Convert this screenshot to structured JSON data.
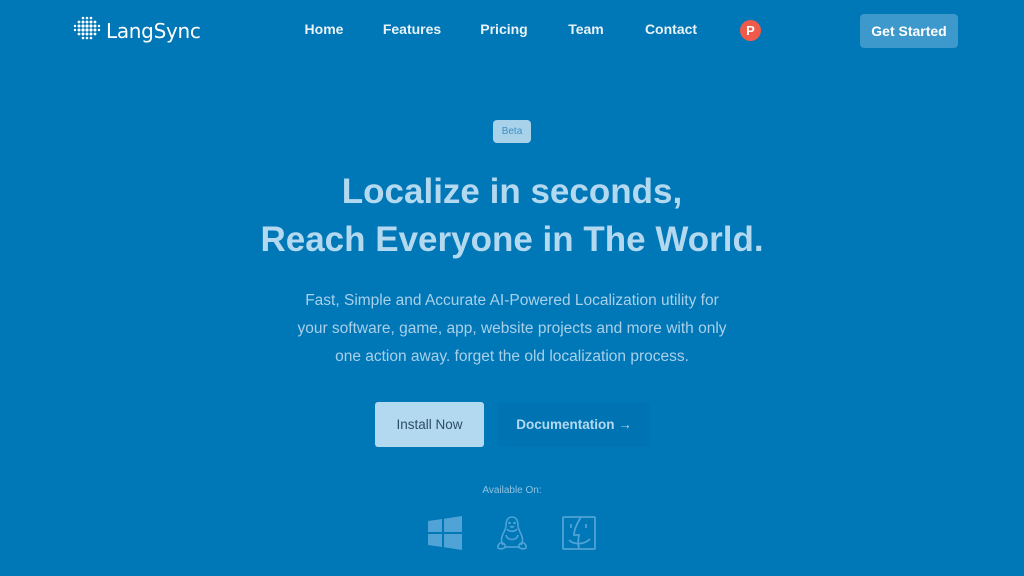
{
  "brand": {
    "name": "LangSync",
    "logo_icon": "globe-dots-icon"
  },
  "nav": {
    "links": [
      {
        "label": "Home"
      },
      {
        "label": "Features"
      },
      {
        "label": "Pricing"
      },
      {
        "label": "Team"
      },
      {
        "label": "Contact"
      }
    ],
    "product_hunt_badge": "P",
    "cta_label": "Get Started"
  },
  "hero": {
    "badge": "Beta",
    "headline_line1": "Localize in seconds,",
    "headline_line2": "Reach Everyone in The World.",
    "subtext_line1": "Fast, Simple and Accurate AI-Powered Localization utility for",
    "subtext_line2": "your software, game, app, website projects and more with only",
    "subtext_line3": "one action away. forget the old localization process.",
    "primary_button": "Install Now",
    "secondary_button": "Documentation →",
    "available_label": "Available On:",
    "platforms": [
      {
        "name": "Windows",
        "icon": "windows-icon"
      },
      {
        "name": "Linux",
        "icon": "linux-tux-icon"
      },
      {
        "name": "macOS",
        "icon": "mac-finder-icon"
      }
    ]
  },
  "colors": {
    "background": "#0077b6",
    "headline": "#b3d9f0",
    "product_hunt": "#f05a4a",
    "cta": "#3d98cc"
  }
}
